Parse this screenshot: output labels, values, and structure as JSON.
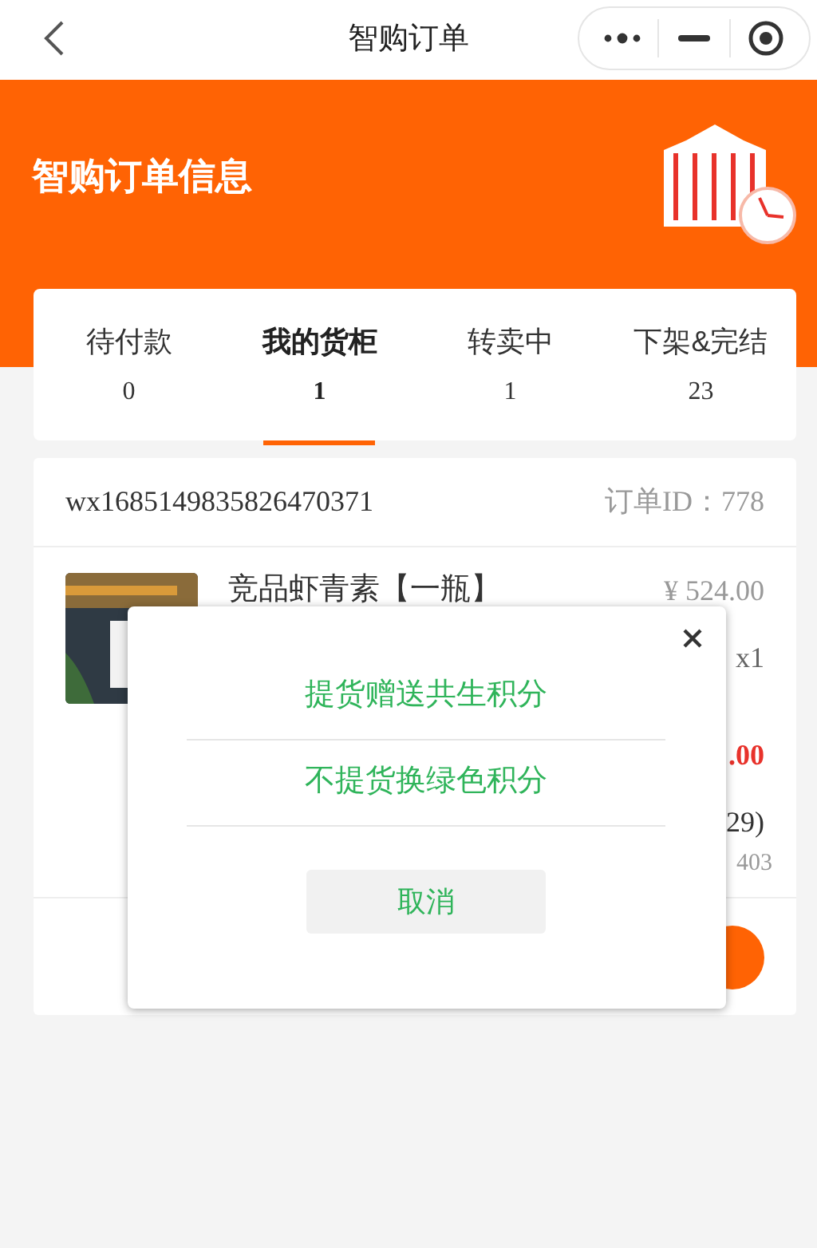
{
  "nav": {
    "title": "智购订单"
  },
  "banner": {
    "title": "智购订单信息"
  },
  "tabs": [
    {
      "label": "待付款",
      "count": "0",
      "selected": false
    },
    {
      "label": "我的货柜",
      "count": "1",
      "selected": true
    },
    {
      "label": "转卖中",
      "count": "1",
      "selected": false
    },
    {
      "label": "下架&完结",
      "count": "23",
      "selected": false
    }
  ],
  "order": {
    "number": "wx1685149835826470371",
    "order_id": "订单ID：778",
    "product": {
      "kind": "picture",
      "name": "竞品虾青素【一瓶】",
      "price": "¥ 524.00",
      "quantity": "x1",
      "total": ".00",
      "line_4": "29)",
      "line_5": "403"
    }
  },
  "dialog": {
    "options": [
      "提货赠送共生积分",
      "不提货换绿色积分"
    ],
    "cancel": "取消"
  }
}
